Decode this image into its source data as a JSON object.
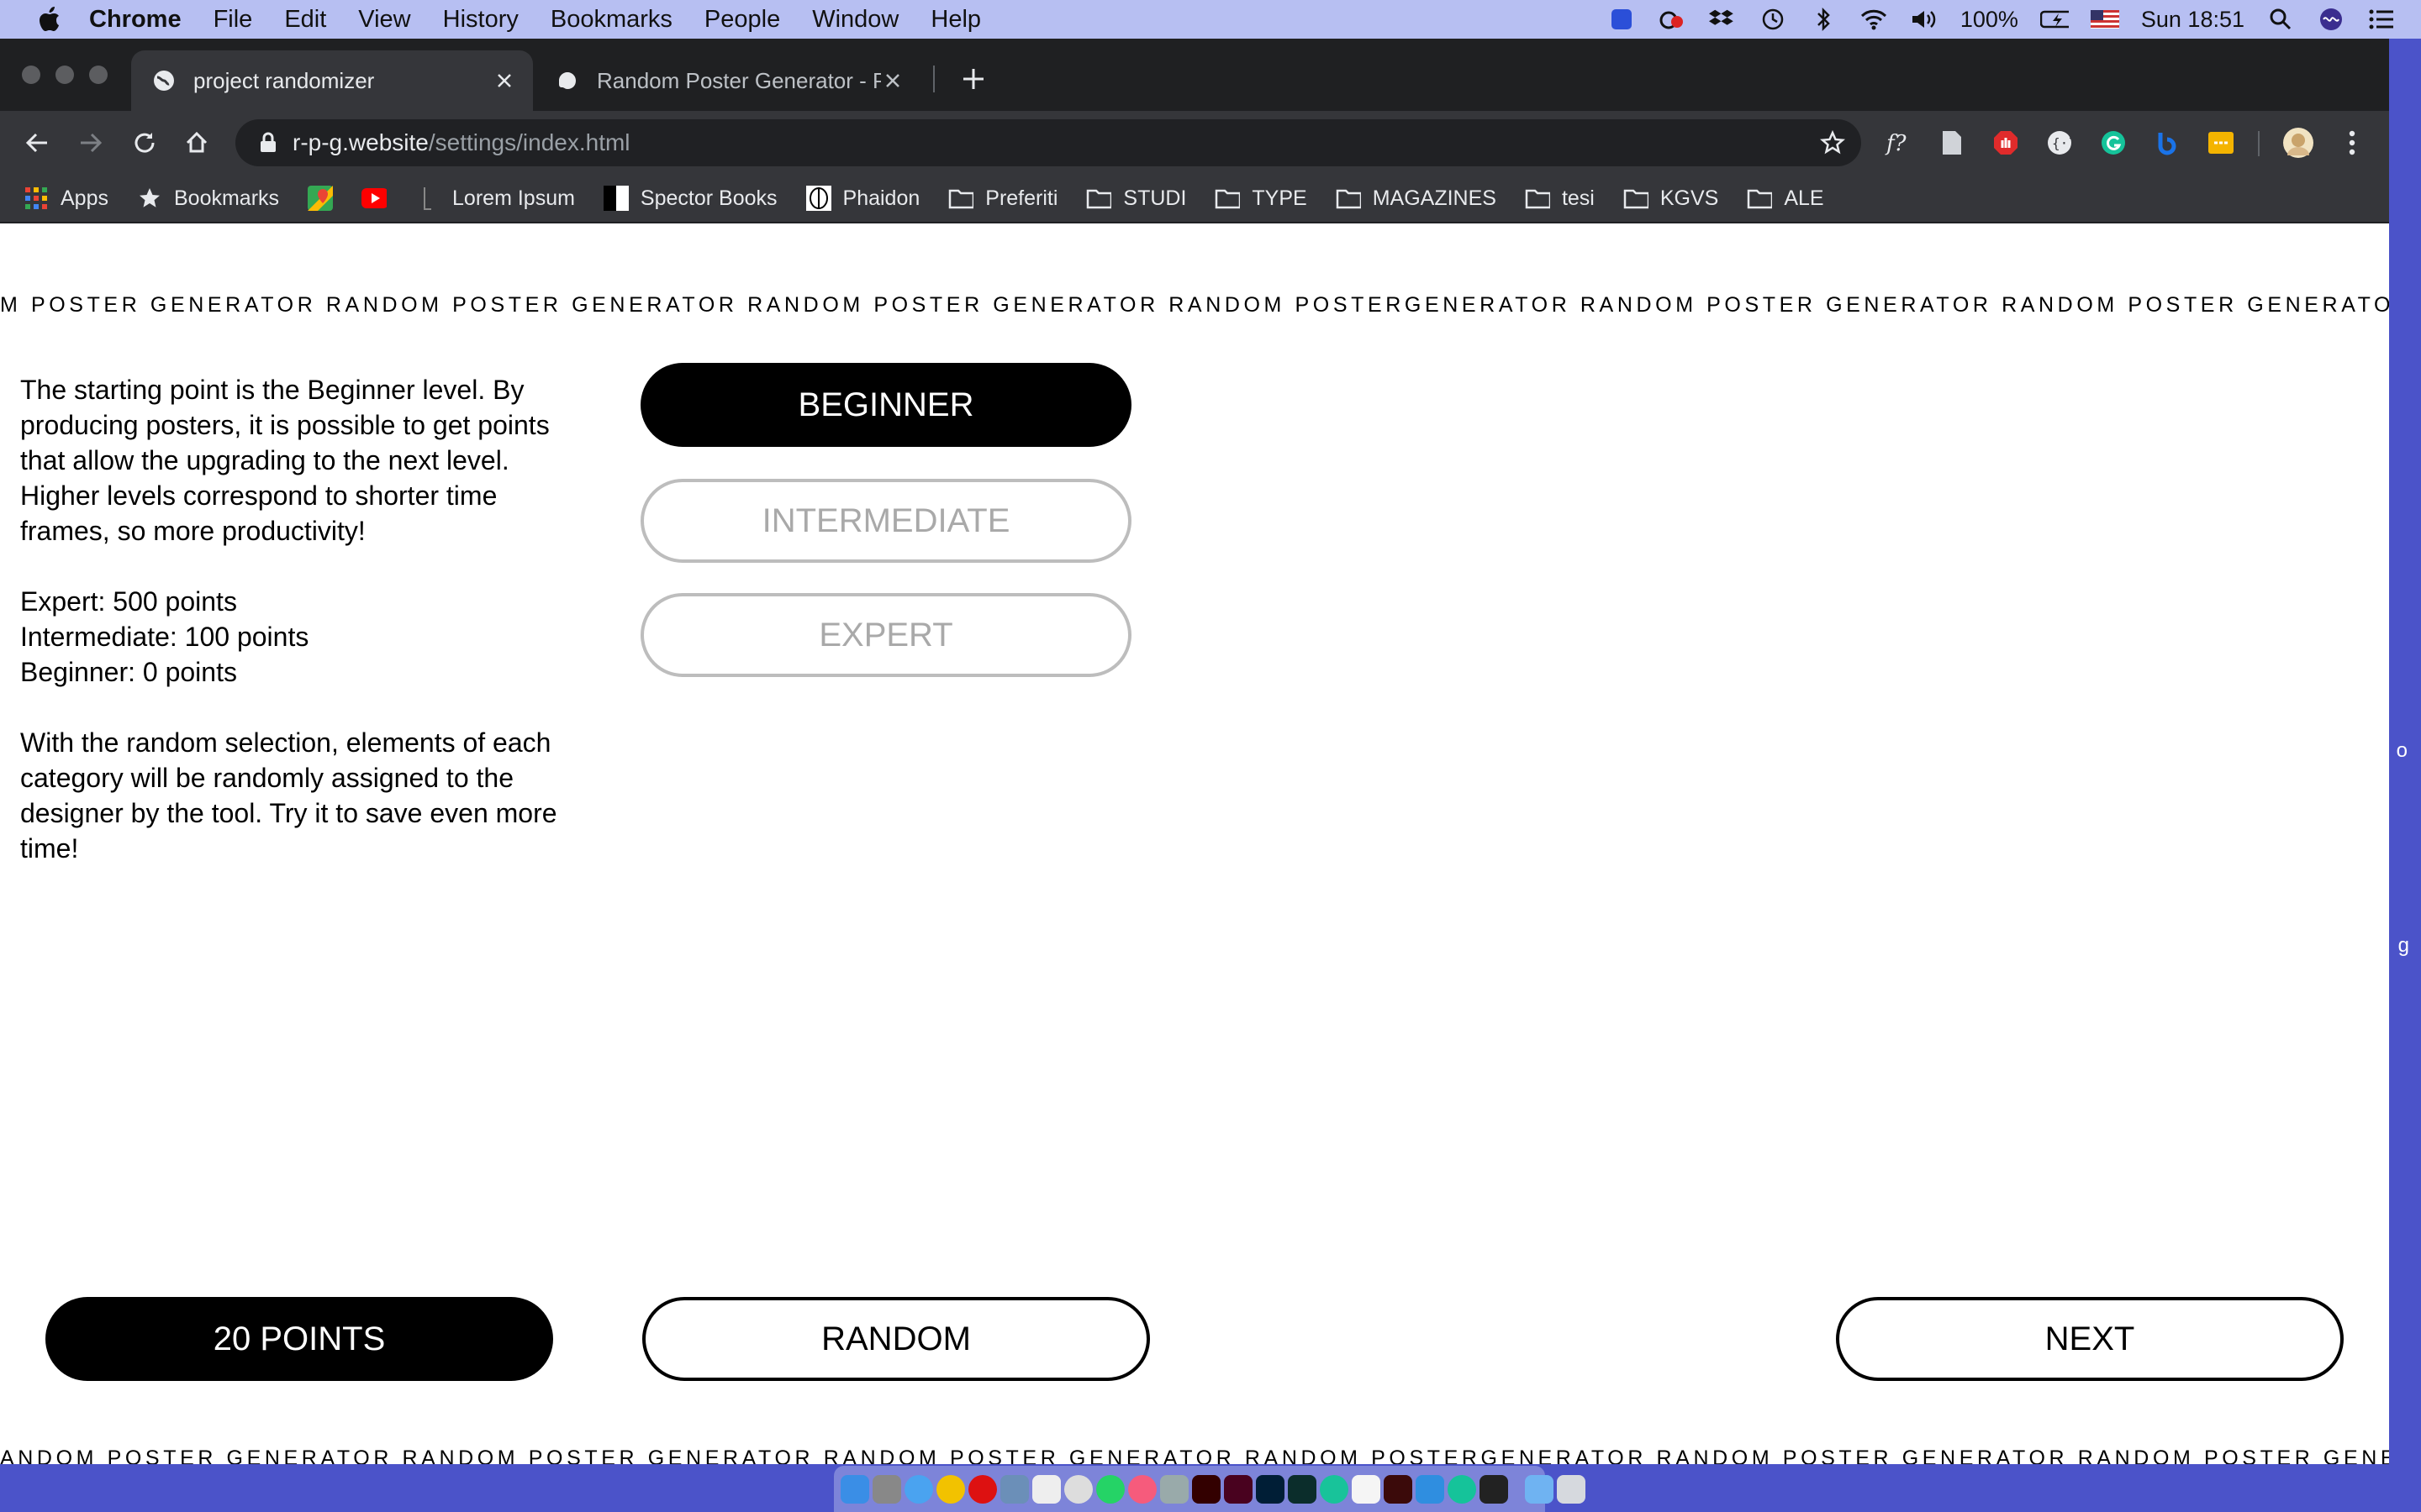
{
  "menubar": {
    "app_name": "Chrome",
    "menus": [
      "File",
      "Edit",
      "View",
      "History",
      "Bookmarks",
      "People",
      "Window",
      "Help"
    ],
    "battery": "100%",
    "clock": "Sun 18:51"
  },
  "tabs": [
    {
      "title": "project randomizer"
    },
    {
      "title": "Random Poster Generator - Po"
    }
  ],
  "address_bar": {
    "domain": "r-p-g.website",
    "path": "/settings/index.html"
  },
  "bookmarks": [
    "Apps",
    "Bookmarks",
    "Lorem Ipsum",
    "Spector Books",
    "Phaidon",
    "Preferiti",
    "STUDI",
    "TYPE",
    "MAGAZINES",
    "tesi",
    "KGVS",
    "ALE"
  ],
  "page": {
    "marquee_top": "M POSTER GENERATOR RANDOM POSTER GENERATOR RANDOM POSTER GENERATOR RANDOM POSTERGENERATOR RANDOM POSTER GENERATOR RANDOM POSTER GENERATOR",
    "marquee_bottom": "ANDOM POSTER GENERATOR RANDOM POSTER GENERATOR RANDOM POSTER GENERATOR RANDOM POSTERGENERATOR RANDOM POSTER GENERATOR RANDOM POSTER GENERATOR",
    "intro_paragraph": "The starting point is the Beginner level. By producing posters, it is possible to get points that allow the upgrading to the next level. Higher levels correspond to shorter time frames, so more productivity!",
    "levels_points": [
      "Expert: 500 points",
      "Intermediate: 100 points",
      "Beginner: 0 points"
    ],
    "random_paragraph": "With the random selection, elements of each category will be randomly assigned to the designer by the tool. Try it to save even more time!",
    "level_buttons": [
      "BEGINNER",
      "INTERMEDIATE",
      "EXPERT"
    ],
    "selected_level": "BEGINNER",
    "points_button": "20 POINTS",
    "random_button": "RANDOM",
    "next_button": "NEXT",
    "edge_text_1": "o",
    "edge_text_2": "g"
  }
}
